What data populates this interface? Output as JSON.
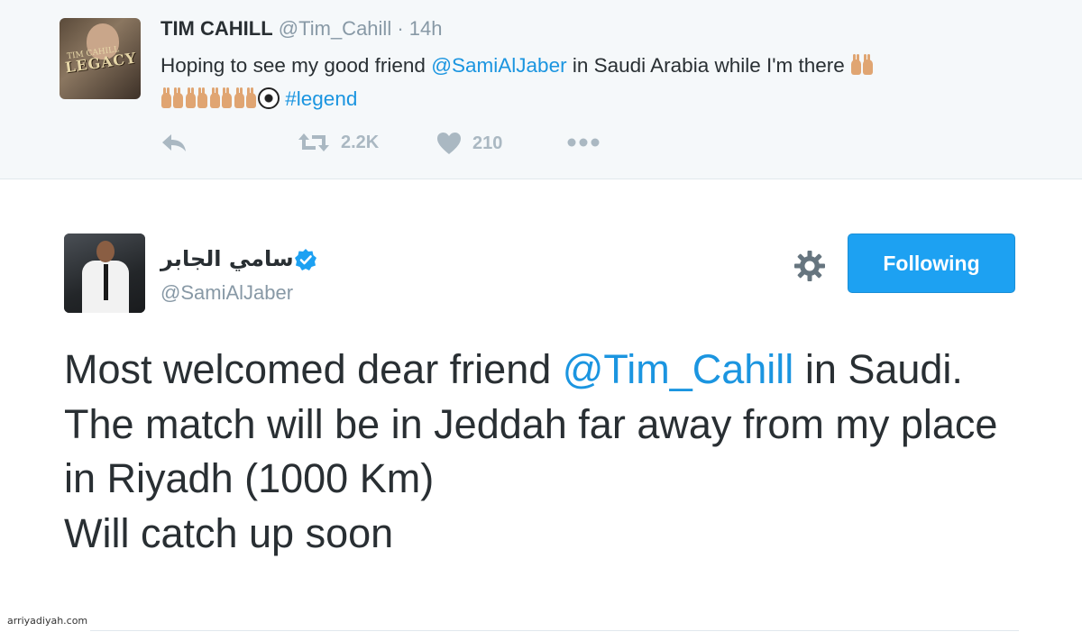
{
  "top_tweet": {
    "author_name": "TIM CAHILL",
    "handle": "@Tim_Cahill",
    "separator": "·",
    "time": "14h",
    "avatar_title": "LEGACY",
    "avatar_subtitle": "TIM CAHILL",
    "text_before_mention": "Hoping to see my good friend ",
    "mention": "@SamiAlJaber",
    "text_after_mention": " in Saudi Arabia while I'm there ",
    "hashtag": "#legend",
    "emojis": [
      "raising-hands-icon",
      "raising-hands-icon",
      "raising-hands-icon",
      "raising-hands-icon",
      "raising-hands-icon",
      "soccer-ball-icon"
    ],
    "actions": {
      "reply_icon": "reply-icon",
      "retweet_icon": "retweet-icon",
      "retweet_count": "2.2K",
      "like_icon": "heart-icon",
      "like_count": "210",
      "more_icon": "more-icon"
    }
  },
  "main_tweet": {
    "author_name": "سامي الجابر",
    "verified_icon": "verified-badge-icon",
    "handle": "@SamiAlJaber",
    "settings_icon": "gear-icon",
    "follow_button_label": "Following",
    "text_line1_before": "Most welcomed dear friend ",
    "text_line1_mention": "@Tim_Cahill",
    "text_line1_after": " in Saudi.",
    "text_line2": "The match will be in Jeddah far away from my place in Riyadh (1000 Km)",
    "text_line3": "Will catch up soon"
  },
  "watermark": "arriyadiyah.com",
  "colors": {
    "link": "#1b95e0",
    "button": "#1da1f2",
    "muted": "#8899a6",
    "icon_gray": "#aab8c2",
    "top_bg": "#f5f8fa"
  }
}
